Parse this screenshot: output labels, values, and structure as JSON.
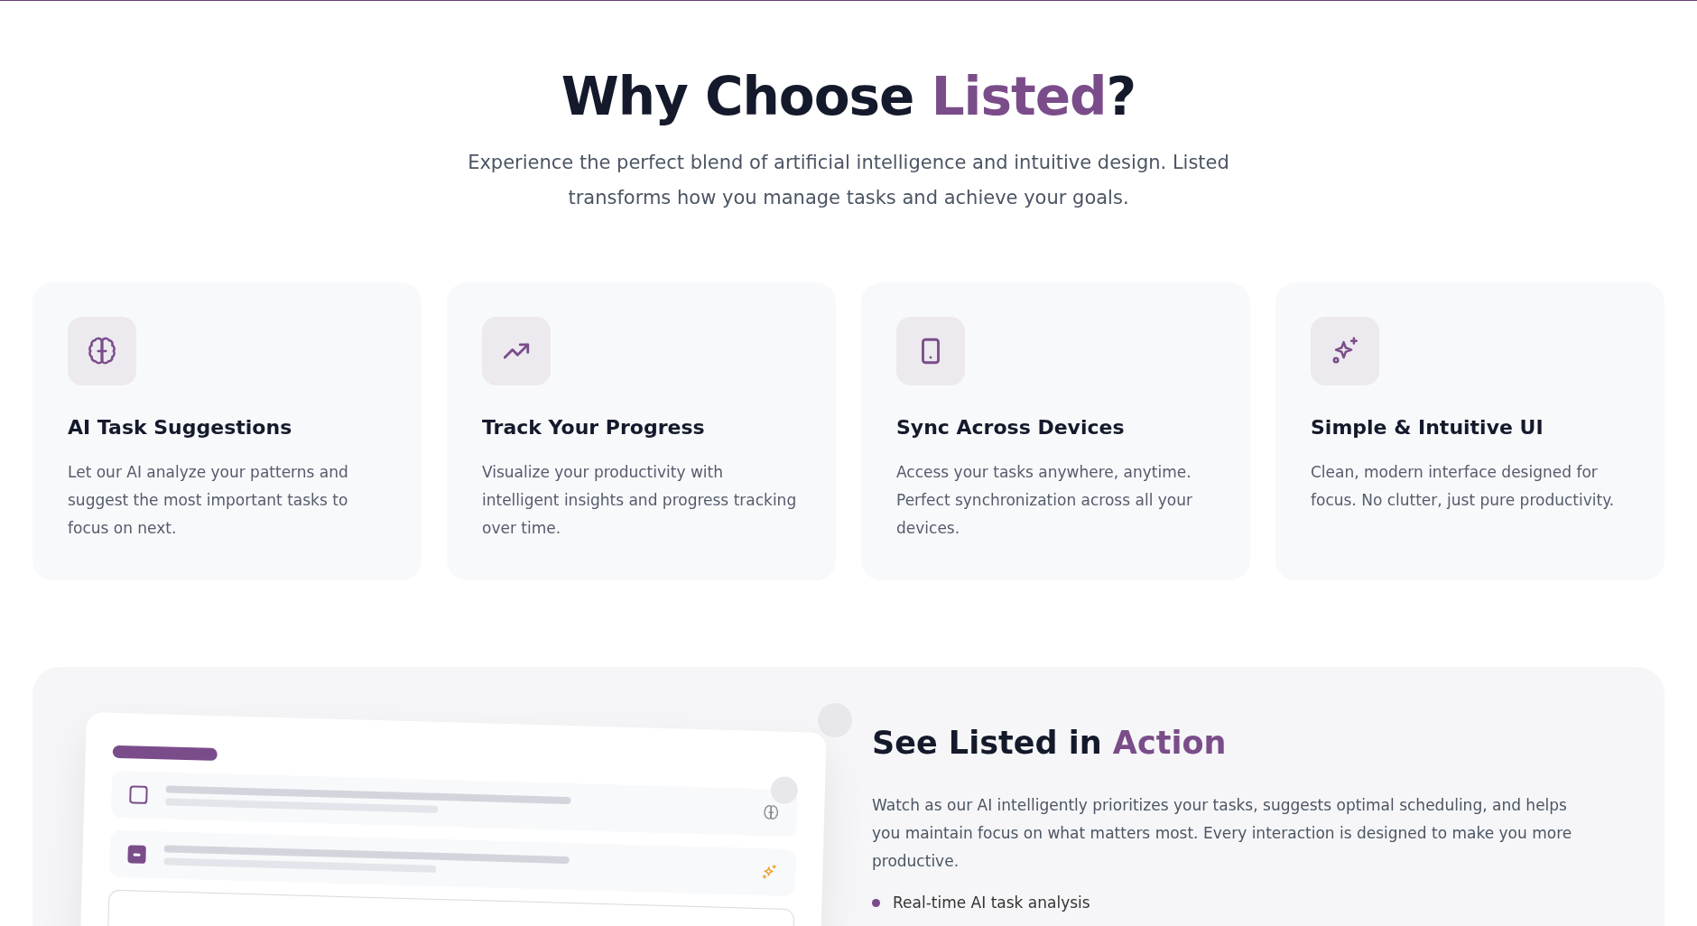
{
  "header": {
    "title": "Why Choose ",
    "title_highlight": "Listed",
    "title_suffix": "?",
    "subtitle": "Experience the perfect blend of artificial intelligence and intuitive design. Listed transforms how you manage tasks and achieve your goals."
  },
  "features": [
    {
      "title": "AI Task Suggestions",
      "description": "Let our AI analyze your patterns and suggest the most important tasks to focus on next."
    },
    {
      "title": "Track Your Progress",
      "description": "Visualize your productivity with intelligent insights and progress tracking over time."
    },
    {
      "title": "Sync Across Devices",
      "description": "Access your tasks anywhere, anytime. Perfect synchronization across all your devices."
    },
    {
      "title": "Simple & Intuitive UI",
      "description": "Clean, modern interface designed for focus. No clutter, just pure productivity."
    }
  ],
  "demo": {
    "title": "See Listed in ",
    "title_highlight": "Action",
    "description": "Watch as our AI intelligently prioritizes your tasks, suggests optimal scheduling, and helps you maintain focus on what matters most. Every interaction is designed to make you more productive.",
    "bullets": [
      "Real-time AI task analysis"
    ],
    "mockup_tasks": [
      {
        "checked": false
      },
      {
        "checked": true
      }
    ]
  }
}
